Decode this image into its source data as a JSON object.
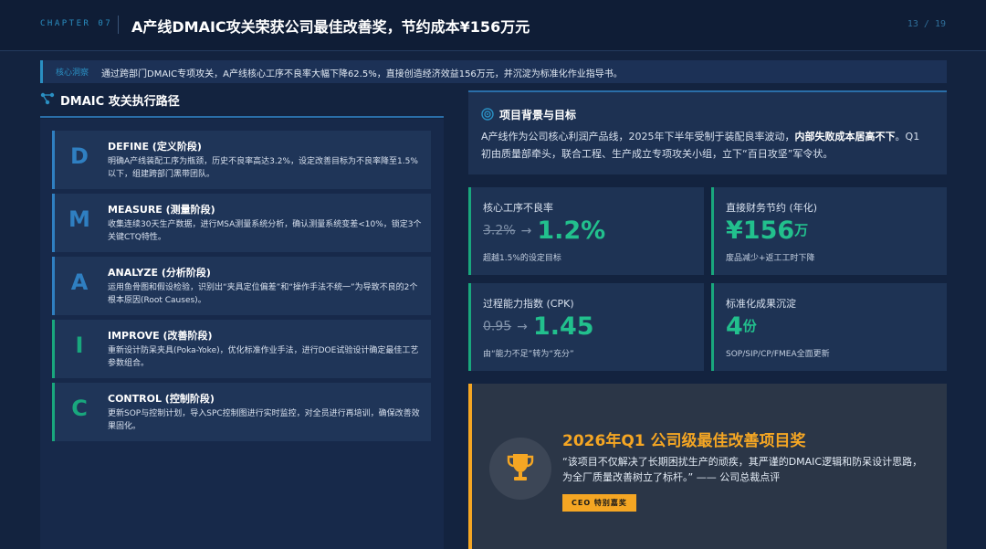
{
  "header": {
    "chapter": "CHAPTER 07",
    "title": "A产线DMAIC攻关荣获公司最佳改善奖，节约成本¥156万元",
    "page": "13 / 19"
  },
  "insight": {
    "label": "核心洞察",
    "text": "通过跨部门DMAIC专项攻关，A产线核心工序不良率大幅下降62.5%，直接创造经济效益156万元，并沉淀为标准化作业指导书。"
  },
  "left": {
    "title": "DMAIC 攻关执行路径",
    "steps": [
      {
        "letter": "D",
        "title": "DEFINE (定义阶段)",
        "desc": "明确A产线装配工序为瓶颈，历史不良率高达3.2%，设定改善目标为不良率降至1.5%以下，组建跨部门黑带团队。",
        "color": "#2f7fc1"
      },
      {
        "letter": "M",
        "title": "MEASURE (测量阶段)",
        "desc": "收集连续30天生产数据，进行MSA测量系统分析，确认测量系统变差<10%，锁定3个关键CTQ特性。",
        "color": "#2f7fc1"
      },
      {
        "letter": "A",
        "title": "ANALYZE (分析阶段)",
        "desc": "运用鱼骨图和假设检验，识别出“夹具定位偏差”和“操作手法不统一”为导致不良的2个根本原因(Root Causes)。",
        "color": "#2f7fc1"
      },
      {
        "letter": "I",
        "title": "IMPROVE (改善阶段)",
        "desc": "重新设计防呆夹具(Poka-Yoke)，优化标准作业手法，进行DOE试验设计确定最佳工艺参数组合。",
        "color": "#19a77d"
      },
      {
        "letter": "C",
        "title": "CONTROL (控制阶段)",
        "desc": "更新SOP与控制计划，导入SPC控制图进行实时监控，对全员进行再培训，确保改善效果固化。",
        "color": "#19a77d"
      }
    ]
  },
  "background": {
    "title": "项目背景与目标",
    "text_before": "A产线作为公司核心利润产品线，2025年下半年受制于装配良率波动，",
    "text_bold": "内部失败成本居高不下",
    "text_after": "。Q1初由质量部牵头，联合工程、生产成立专项攻关小组，立下“百日攻坚”军令状。"
  },
  "metrics": [
    {
      "label": "核心工序不良率",
      "old": "3.2%",
      "arrow": "→",
      "new": "1.2%",
      "unit": "",
      "sub": "超越1.5%的设定目标"
    },
    {
      "label": "直接财务节约 (年化)",
      "old": "",
      "arrow": "",
      "new": "¥156",
      "unit": "万",
      "sub": "废品减少+返工工时下降"
    },
    {
      "label": "过程能力指数 (CPK)",
      "old": "0.95",
      "arrow": "→",
      "new": "1.45",
      "unit": "",
      "sub": "由“能力不足”转为“充分”"
    },
    {
      "label": "标准化成果沉淀",
      "old": "",
      "arrow": "",
      "new": "4",
      "unit": "份",
      "sub": "SOP/SIP/CP/FMEA全面更新"
    }
  ],
  "award": {
    "title": "2026年Q1 公司级最佳改善项目奖",
    "quote": "“该项目不仅解决了长期困扰生产的顽疾，其严谨的DMAIC逻辑和防呆设计思路，为全厂质量改善树立了标杆。” —— 公司总裁点评",
    "badge": "CEO 特别嘉奖"
  },
  "colors": {
    "accent_blue": "#2a8fc2",
    "accent_green": "#22c08d",
    "accent_gold": "#f5a623"
  }
}
